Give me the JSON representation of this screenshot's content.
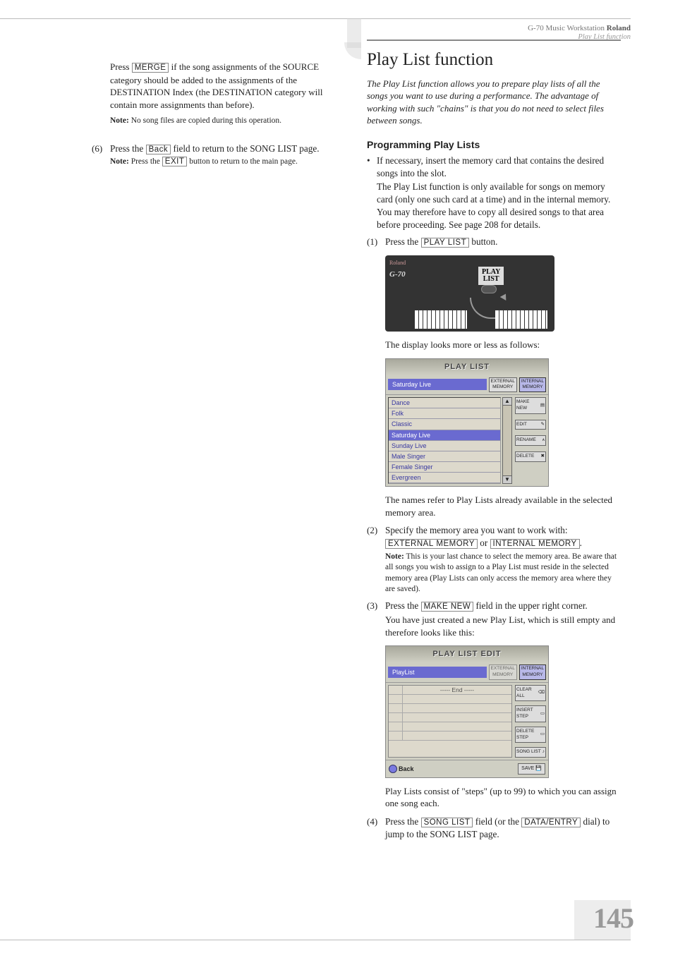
{
  "header": {
    "product": "G-70 Music Workstation",
    "brand": "Roland",
    "section": "Play List function"
  },
  "left": {
    "p1_a": "Press ",
    "btn_merge": "MERGE",
    "p1_b": " if the song assignments of the SOURCE category should be added to the assignments of the DESTINATION Index (the DESTINATION category will contain more assignments than before).",
    "note1_label": "Note:",
    "note1_text": " No song files are copied during this operation.",
    "step6_num": "(6)",
    "step6_a": "Press the ",
    "btn_back": "Back",
    "step6_b": " field to return to the SONG LIST page.",
    "note2_label": "Note:",
    "note2_a": " Press the ",
    "btn_exit": "EXIT",
    "note2_b": " button to return to the main page."
  },
  "right": {
    "h2": "Play List function",
    "intro": "The Play List function allows you to prepare play lists of all the songs you want to use during a performance. The advantage of working with such \"chains\" is that you do not need to select files between songs.",
    "h3": "Programming Play Lists",
    "bullet1": "If necessary, insert the memory card that contains the desired songs into the slot.",
    "bullet1_body": "The Play List function is only available for songs on memory card (only one such card at a time) and in the internal memory. You may therefore have to copy all desired songs to that area before proceeding. See page 208 for details.",
    "step1_num": "(1)",
    "step1_a": "Press the ",
    "btn_playlist": "PLAY LIST",
    "step1_b": " button.",
    "device_play_label": "PLAY\nLIST",
    "device_brand": "Roland",
    "device_model": "G-70",
    "after_img1": "The display looks more or less as follows:",
    "screen1": {
      "title": "PLAY LIST",
      "selected": "Saturday Live",
      "top_btn1": "EXTERNAL\nMEMORY",
      "top_btn2": "INTERNAL\nMEMORY",
      "items": [
        "Dance",
        "Folk",
        "Classic",
        "Saturday Live",
        "Sunday Live",
        "Male Singer",
        "Female Singer",
        "Evergreen"
      ],
      "sel_index": 3,
      "side": [
        "MAKE NEW",
        "EDIT",
        "RENAME",
        "DELETE"
      ]
    },
    "after_screen1": "The names refer to Play Lists already available in the selected memory area.",
    "step2_num": "(2)",
    "step2_a": "Specify the memory area you want to work with: ",
    "btn_ext": "EXTERNAL MEMORY",
    "step2_or": " or ",
    "btn_int": "INTERNAL MEMORY",
    "step2_c": ".",
    "note3_label": "Note:",
    "note3_text": " This is your last chance to select the memory area. Be aware that all songs you wish to assign to a Play List must reside in the selected memory area (Play Lists can only access the memory area where they are saved).",
    "step3_num": "(3)",
    "step3_a": "Press the ",
    "btn_makenew": "MAKE NEW",
    "step3_b": " field in the upper right corner.",
    "step3_body": "You have just created a new Play List, which is still empty and therefore looks like this:",
    "screen2": {
      "title": "PLAY LIST EDIT",
      "selected": "PlayList",
      "top_btn1": "EXTERNAL\nMEMORY",
      "top_btn2": "INTERNAL\nMEMORY",
      "end": "----- End -----",
      "side": [
        "CLEAR ALL",
        "INSERT STEP",
        "DELETE STEP",
        "SONG LIST"
      ],
      "back": "Back",
      "save": "SAVE"
    },
    "after_screen2": "Play Lists consist of \"steps\" (up to 99) to which you can assign one song each.",
    "step4_num": "(4)",
    "step4_a": "Press the ",
    "btn_songlist": "SONG LIST",
    "step4_b": " field (or the ",
    "btn_dataentry": "DATA/ENTRY",
    "step4_c": " dial) to jump to the SONG LIST page."
  },
  "page_num": "145"
}
